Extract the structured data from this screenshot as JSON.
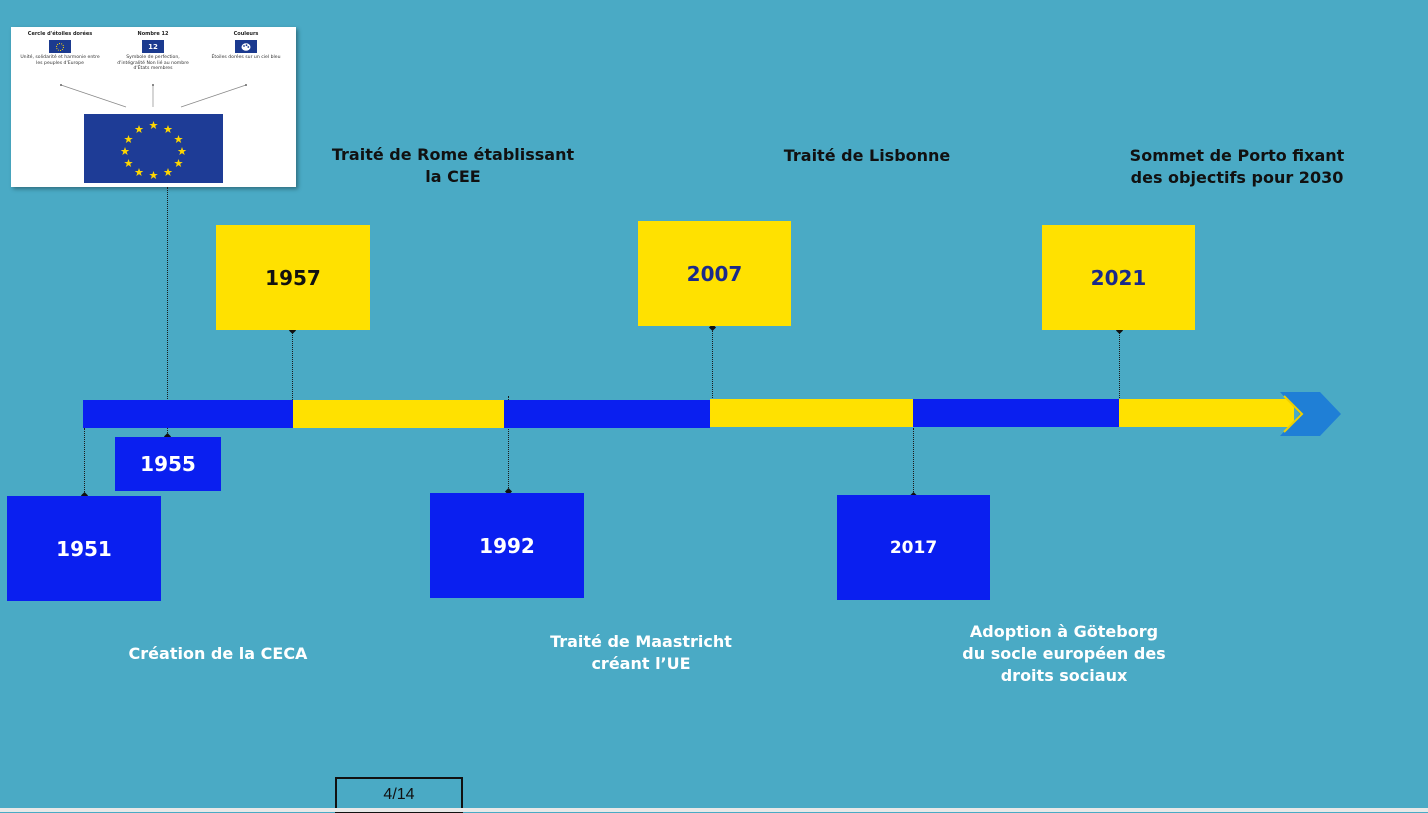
{
  "infographic": {
    "columns": [
      {
        "title": "Cercle d'étoiles dorées",
        "icon": "star-circle-icon",
        "text": "Unité, solidarité et harmonie entre les peuples d'Europe"
      },
      {
        "title": "Nombre 12",
        "icon_text": "12",
        "text": "Symbole de perfection, d'intégralité Non lié au nombre d'États membres"
      },
      {
        "title": "Couleurs",
        "icon": "palette-icon",
        "text": "Étoiles dorées sur un ciel bleu"
      }
    ]
  },
  "years": {
    "y1951": "1951",
    "y1955": "1955",
    "y1957": "1957",
    "y1992": "1992",
    "y2007": "2007",
    "y2017": "2017",
    "y2021": "2021"
  },
  "events": {
    "ceca": "Création de la CECA",
    "rome_1": "Traité de Rome établissant",
    "rome_2": "la CEE",
    "maastricht_1": "Traité de Maastricht",
    "maastricht_2": "créant l’UE",
    "lisbonne": "Traité de Lisbonne",
    "goteborg_1": "Adoption à Göteborg",
    "goteborg_2": "du socle européen des",
    "goteborg_3": "droits sociaux",
    "porto_1": "Sommet de Porto fixant",
    "porto_2": "des objectifs pour 2030"
  },
  "pager": {
    "label": "4/14"
  },
  "colors": {
    "background": "#4aaac5",
    "eu_blue": "#0a1ff0",
    "eu_yellow": "#ffe100",
    "year_text_dark_blue": "#1a2a8a",
    "arrow_blue": "#1f7fd6"
  }
}
